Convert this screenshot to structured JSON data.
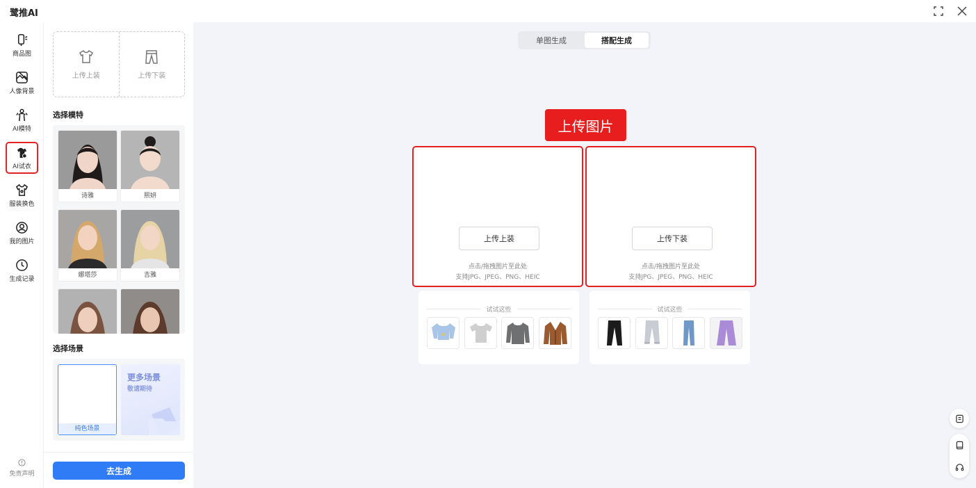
{
  "app": {
    "title": "鹭推AI"
  },
  "rail": {
    "items": [
      {
        "label": "商品图",
        "icon": "product-image-icon"
      },
      {
        "label": "人像背景",
        "icon": "portrait-background-icon"
      },
      {
        "label": "AI模特",
        "icon": "ai-model-icon"
      },
      {
        "label": "AI试衣",
        "icon": "ai-tryon-icon",
        "active": true
      },
      {
        "label": "服装换色",
        "icon": "recolor-icon"
      },
      {
        "label": "我的图片",
        "icon": "my-images-icon"
      },
      {
        "label": "生成记录",
        "icon": "history-icon"
      }
    ],
    "disclaimer": "免责声明"
  },
  "panel": {
    "upload_top": "上传上装",
    "upload_bottom": "上传下装",
    "model_title": "选择模特",
    "models": [
      {
        "name": "诗雅"
      },
      {
        "name": "熙妍"
      },
      {
        "name": "娜塔莎"
      },
      {
        "name": "吉雅"
      },
      {
        "name": ""
      },
      {
        "name": ""
      }
    ],
    "scene_title": "选择场景",
    "scene_plain": "纯色场景",
    "scene_more_title": "更多场景",
    "scene_more_sub": "敬请期待",
    "generate": "去生成"
  },
  "main": {
    "tabs": [
      {
        "label": "单图生成",
        "active": false
      },
      {
        "label": "搭配生成",
        "active": true
      }
    ],
    "annotation": "上传图片",
    "slots": [
      {
        "button": "上传上装",
        "hint1": "点击/拖拽图片至此处",
        "hint2": "支持JPG、JPEG、PNG、HEIC"
      },
      {
        "button": "上传下装",
        "hint1": "点击/拖拽图片至此处",
        "hint2": "支持JPG、JPEG、PNG、HEIC"
      }
    ],
    "suggest_title_top": "试试这些",
    "suggest_title_bottom": "试试这些",
    "top_samples": [
      "light-blue-crop-top",
      "grey-tshirt",
      "grey-sweater",
      "brown-leather-jacket"
    ],
    "bottom_samples": [
      "black-pants",
      "grey-sweatpants",
      "blue-jeans",
      "purple-wide-pants"
    ]
  },
  "colors": {
    "accent": "#2f7cf6",
    "annotation_red": "#e81e1e"
  }
}
